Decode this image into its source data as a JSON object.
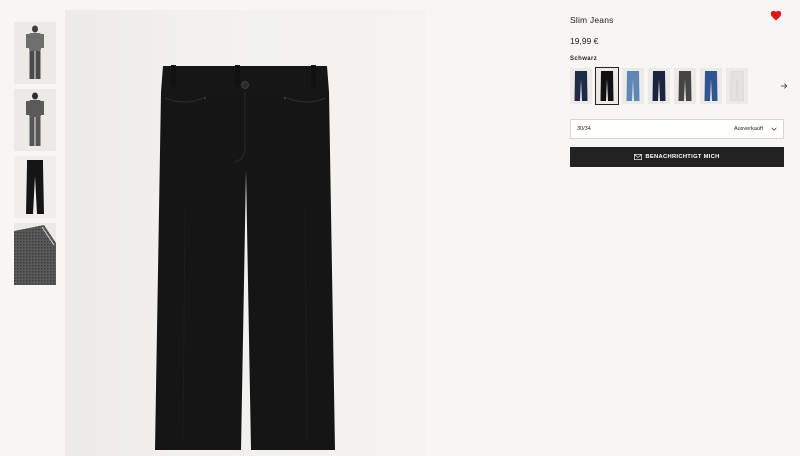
{
  "product": {
    "title": "Slim Jeans",
    "price": "19,99 €",
    "color_label": "Schwarz",
    "favorite_icon": "heart-icon"
  },
  "gallery": {
    "thumbnails": [
      {
        "name": "model-front"
      },
      {
        "name": "model-back"
      },
      {
        "name": "product-flat"
      },
      {
        "name": "fabric-detail"
      }
    ],
    "active_index": 2
  },
  "swatches": [
    {
      "name": "dunkelblau",
      "color": "#1f2a44"
    },
    {
      "name": "schwarz",
      "color": "#111111",
      "selected": true
    },
    {
      "name": "hellblau",
      "color": "#5f87b5"
    },
    {
      "name": "navy",
      "color": "#1c2540"
    },
    {
      "name": "dunkelgrau",
      "color": "#454545"
    },
    {
      "name": "blau",
      "color": "#2f5690"
    },
    {
      "name": "weiss",
      "color": "#e3e2df"
    }
  ],
  "size_select": {
    "size": "30/34",
    "status": "Ausverkauft"
  },
  "notify_button": {
    "label": "BENACHRICHTIGT MICH",
    "icon": "envelope-icon"
  },
  "colors": {
    "accent": "#e0151a",
    "button_bg": "#222222",
    "page_bg": "#f7f6f4"
  }
}
